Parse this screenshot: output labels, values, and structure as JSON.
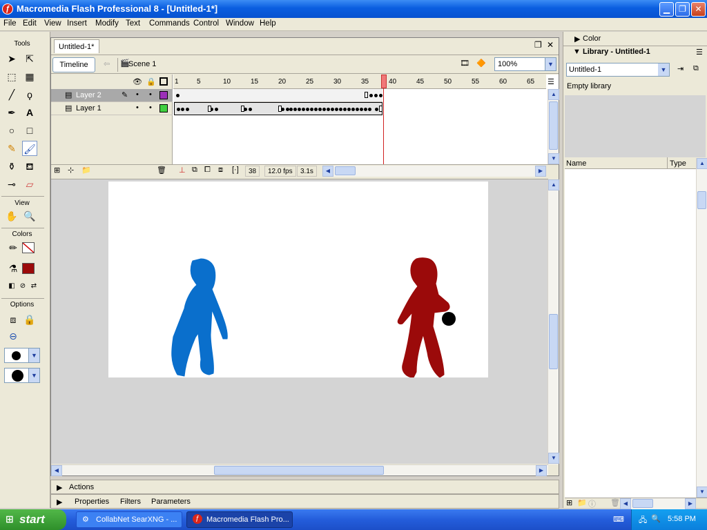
{
  "window": {
    "title": "Macromedia Flash Professional 8 - [Untitled-1*]",
    "icon": "flash-app-icon"
  },
  "menu": [
    "File",
    "Edit",
    "View",
    "Insert",
    "Modify",
    "Text",
    "Commands",
    "Control",
    "Window",
    "Help"
  ],
  "tools": {
    "header": "Tools",
    "view_header": "View",
    "colors_header": "Colors",
    "options_header": "Options"
  },
  "document": {
    "tab": "Untitled-1*",
    "timeline_button": "Timeline",
    "scene": "Scene 1",
    "zoom": "100%",
    "ruler": [
      "1",
      "5",
      "10",
      "15",
      "20",
      "25",
      "30",
      "35",
      "40",
      "45",
      "50",
      "55",
      "60",
      "65"
    ],
    "layers": [
      {
        "name": "Layer 2",
        "selected": true,
        "color": "#9b30b8"
      },
      {
        "name": "Layer 1",
        "selected": false,
        "color": "#40d040"
      }
    ],
    "status": {
      "frame": "38",
      "fps": "12.0 fps",
      "time": "3.1s"
    }
  },
  "stage": {
    "background": "#ffffff",
    "figure_left_color": "#0a6fcc",
    "figure_right_color": "#9b0a0a",
    "ball_color": "#000000"
  },
  "panels_bottom": {
    "actions": "Actions",
    "tabs": [
      "Properties",
      "Filters",
      "Parameters"
    ]
  },
  "right_panel": {
    "color_header": "Color",
    "library_header": "Library - Untitled-1",
    "library_select": "Untitled-1",
    "empty_text": "Empty library",
    "col_name": "Name",
    "col_type": "Type"
  },
  "taskbar": {
    "start": "start",
    "tasks": [
      "CollabNet SearXNG - ...",
      "Macromedia Flash Pro..."
    ],
    "clock": "5:58 PM"
  }
}
